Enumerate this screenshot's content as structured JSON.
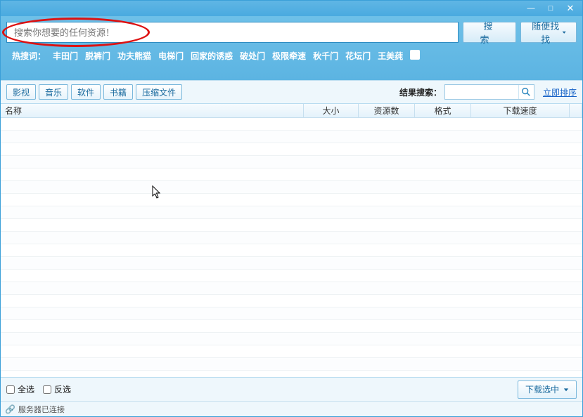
{
  "titlebar": {
    "minimize": "—",
    "maximize": "□",
    "close": "✕"
  },
  "search": {
    "placeholder": "搜索你想要的任何资源！",
    "search_btn": "搜索",
    "random_btn": "随便找找"
  },
  "hot": {
    "label": "热搜词：",
    "items": [
      "丰田门",
      "脱裤门",
      "功夫熊猫",
      "电梯门",
      "回家的诱惑",
      "破处门",
      "极限牵速",
      "秋千门",
      "花坛门",
      "王美莼"
    ]
  },
  "tabs": {
    "items": [
      "影视",
      "音乐",
      "软件",
      "书籍",
      "压缩文件"
    ]
  },
  "filter": {
    "label": "结果搜索：",
    "sort": "立即排序"
  },
  "columns": {
    "name": "名称",
    "size": "大小",
    "resources": "资源数",
    "format": "格式",
    "speed": "下载速度"
  },
  "action": {
    "select_all": "全选",
    "invert": "反选",
    "download_selected": "下载选中"
  },
  "status": {
    "text": "服务器已连接"
  }
}
